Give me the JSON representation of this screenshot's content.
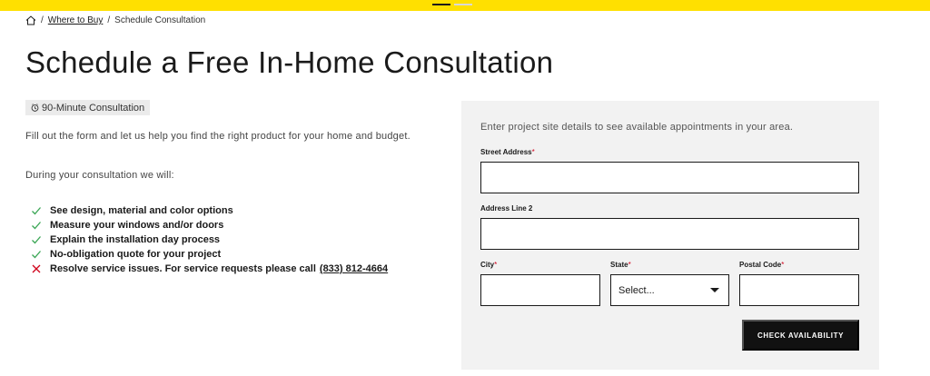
{
  "breadcrumb": {
    "home_icon": "home-icon",
    "separator": "/",
    "link": "Where to Buy",
    "current": "Schedule Consultation"
  },
  "page_title": "Schedule a Free In-Home Consultation",
  "badge": {
    "icon": "clock-icon",
    "label": "90-Minute Consultation"
  },
  "intro": "Fill out the form and let us help you find the right product for your home and budget.",
  "during": "During your consultation we will:",
  "checklist": [
    {
      "icon": "check-icon",
      "text": "See design, material and color options"
    },
    {
      "icon": "check-icon",
      "text": "Measure your windows and/or doors"
    },
    {
      "icon": "check-icon",
      "text": "Explain the installation day process"
    },
    {
      "icon": "check-icon",
      "text": "No-obligation quote for your project"
    },
    {
      "icon": "x-icon",
      "text": "Resolve service issues. For service requests please call",
      "link": "(833) 812-4664"
    }
  ],
  "form": {
    "lead": "Enter project site details to see available appointments in your area.",
    "street_label": "Street Address",
    "address2_label": "Address Line 2",
    "city_label": "City",
    "state_label": "State",
    "postal_label": "Postal Code",
    "required_mark": "*",
    "state_selected": "Select...",
    "submit_label": "CHECK AVAILABILITY"
  },
  "colors": {
    "accent_yellow": "#ffe000",
    "check_green": "#3aa655",
    "error_red": "#d0021b",
    "panel_bg": "#f2f2f2",
    "button_bg": "#111111"
  }
}
